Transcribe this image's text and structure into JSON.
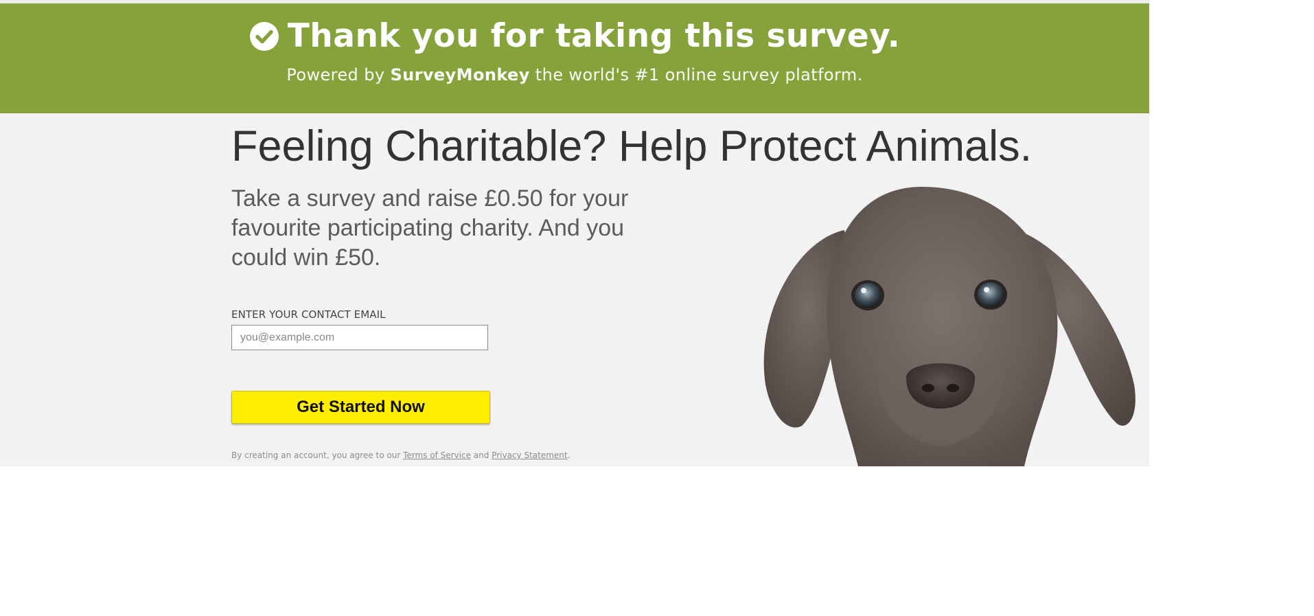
{
  "banner": {
    "title": "Thank you for taking this survey.",
    "subtitle_pre": "Powered by ",
    "subtitle_brand": "SurveyMonkey",
    "subtitle_post": " the world's #1 online survey platform.",
    "background_color": "#86a33b",
    "icon": "check-circle-icon"
  },
  "promo": {
    "headline": "Feeling Charitable? Help Protect Animals.",
    "body": "Take a survey and raise £0.50 for your favourite participating charity. And you could win £50.",
    "email_label": "ENTER YOUR CONTACT EMAIL",
    "email_placeholder": "you@example.com",
    "email_value": "",
    "cta_label": "Get Started Now",
    "cta_color": "#ffee00",
    "legal_pre": "By creating an account, you agree to our ",
    "terms_link": "Terms of Service",
    "legal_and": " and ",
    "privacy_link": "Privacy Statement",
    "legal_post": ".",
    "image": "puppy-photo"
  }
}
